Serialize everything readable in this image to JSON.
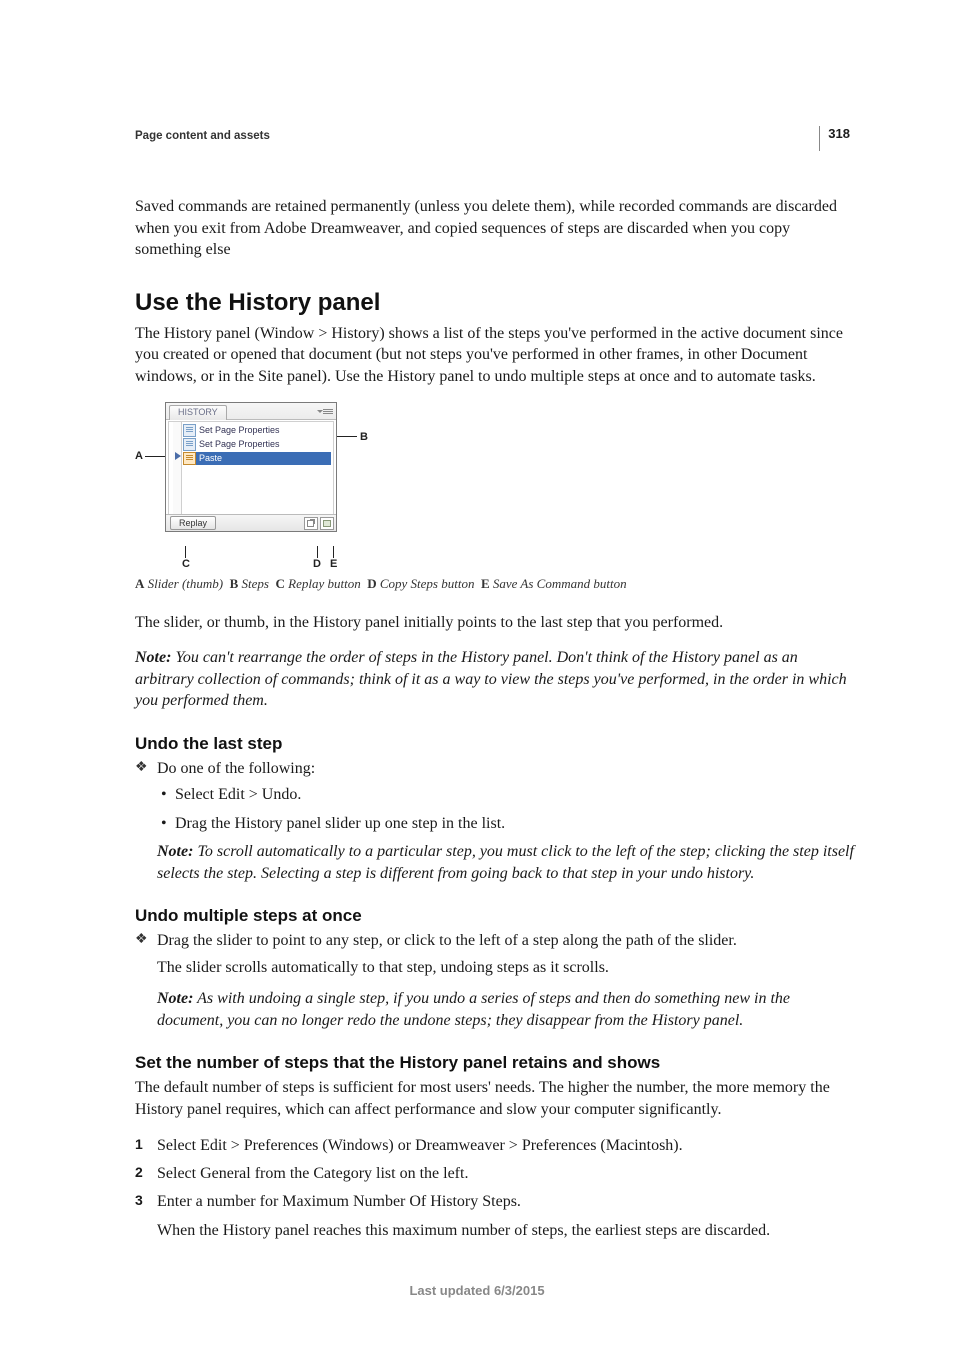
{
  "page_number": "318",
  "section_label": "Page content and assets",
  "intro_paragraph": "Saved commands are retained permanently (unless you delete them), while recorded commands are discarded when you exit from Adobe Dreamweaver, and copied sequences of steps are discarded when you copy something else",
  "h1": "Use the History panel",
  "h1_para": "The History panel (Window > History) shows a list of the steps you've performed in the active document since you created or opened that document (but not steps you've performed in other frames, in other Document windows, or in the Site panel). Use the History panel to undo multiple steps at once and to automate tasks.",
  "figure": {
    "tab_label": "HISTORY",
    "steps": [
      "Set Page Properties",
      "Set Page Properties",
      "Paste"
    ],
    "replay_label": "Replay",
    "callouts": {
      "A": "A",
      "B": "B",
      "C": "C",
      "D": "D",
      "E": "E"
    }
  },
  "caption_parts": {
    "A": "A",
    "A_text": "Slider (thumb)",
    "B": "B",
    "B_text": "Steps",
    "C": "C",
    "C_text": "Replay button",
    "D": "D",
    "D_text": "Copy Steps button",
    "E": "E",
    "E_text": "Save As Command button"
  },
  "after_fig_para": "The slider, or thumb, in the History panel initially points to the last step that you performed.",
  "note1_lead": "Note:",
  "note1_text": " You can't rearrange the order of steps in the History panel. Don't think of the History panel as an arbitrary collection of commands; think of it as a way to view the steps you've performed, in the order in which you performed them.",
  "h2a": "Undo the last step",
  "h2a_lead": "Do one of the following:",
  "h2a_bullets": [
    "Select Edit > Undo.",
    "Drag the History panel slider up one step in the list."
  ],
  "note2_lead": "Note:",
  "note2_text": " To scroll automatically to a particular step, you must click to the left of the step; clicking the step itself selects the step. Selecting a step is different from going back to that step in your undo history.",
  "h2b": "Undo multiple steps at once",
  "h2b_lead": "Drag the slider to point to any step, or click to the left of a step along the path of the slider.",
  "h2b_para": "The slider scrolls automatically to that step, undoing steps as it scrolls.",
  "note3_lead": "Note:",
  "note3_text": " As with undoing a single step, if you undo a series of steps and then do something new in the document, you can no longer redo the undone steps; they disappear from the History panel.",
  "h2c": "Set the number of steps that the History panel retains and shows",
  "h2c_para": "The default number of steps is sufficient for most users' needs. The higher the number, the more memory the History panel requires, which can affect performance and slow your computer significantly.",
  "h2c_steps": [
    "Select Edit > Preferences (Windows) or Dreamweaver > Preferences (Macintosh).",
    "Select General from the Category list on the left.",
    "Enter a number for Maximum Number Of History Steps."
  ],
  "h2c_tail": "When the History panel reaches this maximum number of steps, the earliest steps are discarded.",
  "footer": "Last updated 6/3/2015"
}
